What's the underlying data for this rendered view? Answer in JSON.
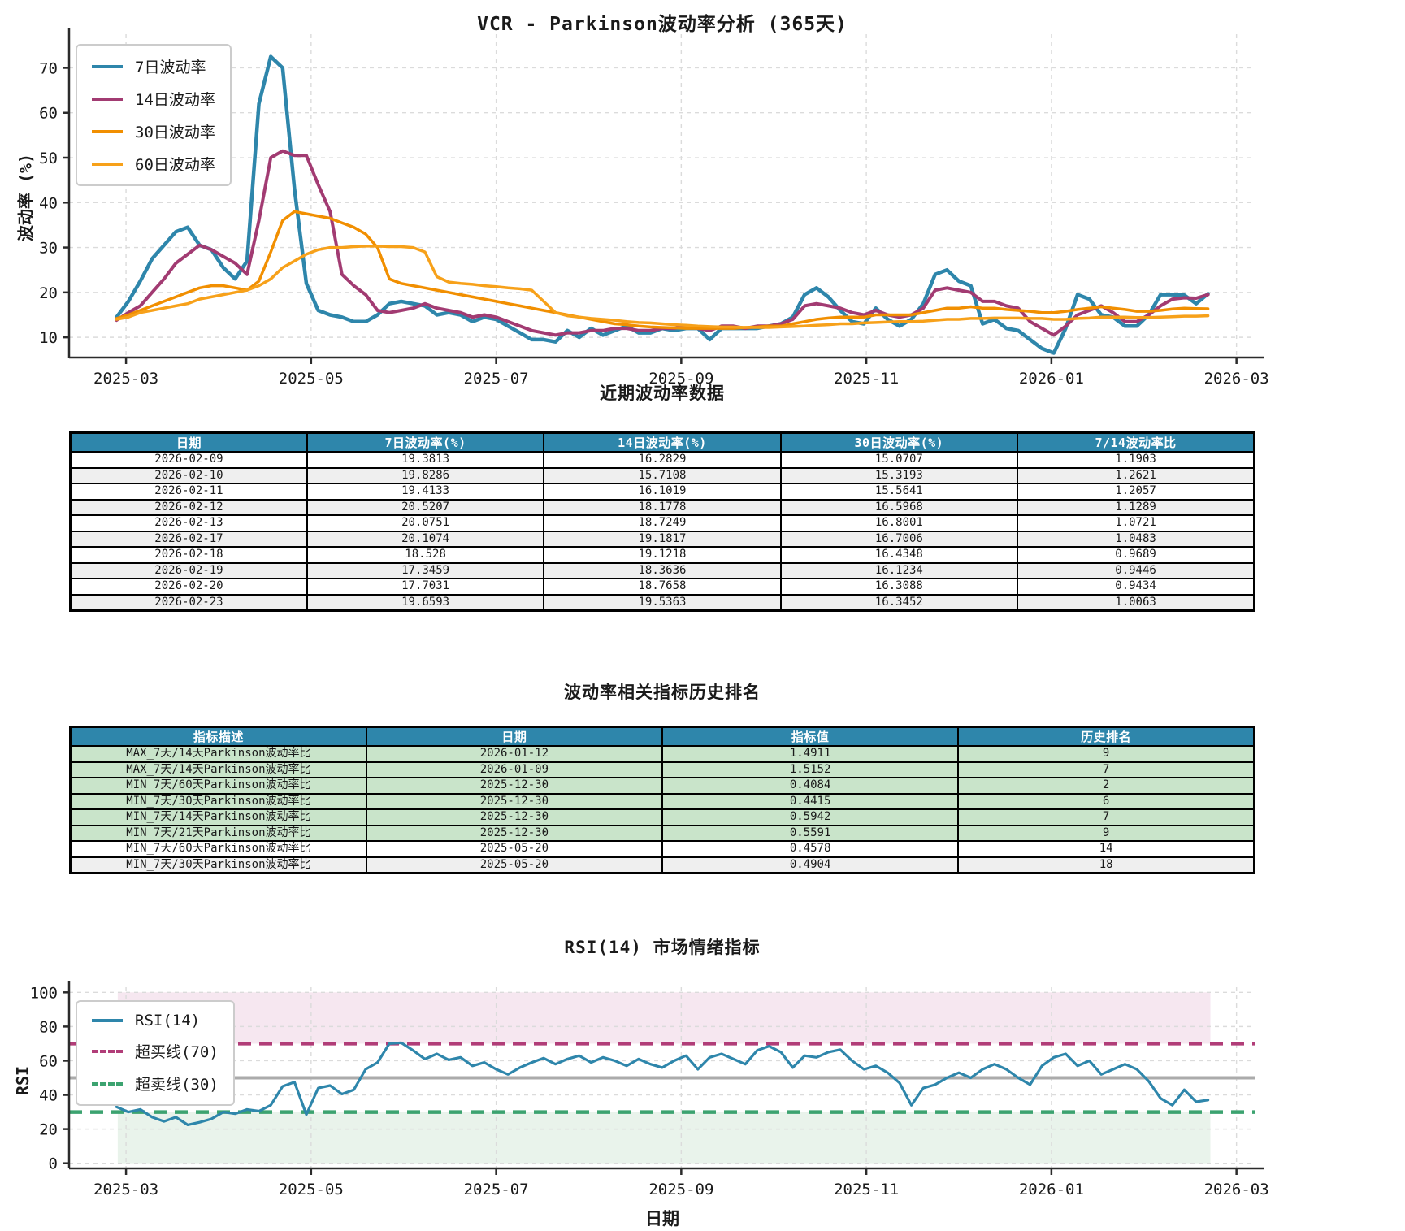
{
  "colors": {
    "vol7": "#2E86AB",
    "vol14": "#A23B72",
    "vol30": "#F18F01",
    "vol60": "#F7A11A",
    "rsi_line": "#2E86AB",
    "overbought": "#B13D78",
    "oversold": "#3CA370",
    "midline": "#ABABAB",
    "band_pink": "#F6E7F0",
    "band_green": "#E9F3EB",
    "header_bg": "#2E86AB",
    "row_alt": "#EFEFEF",
    "row_green": "#C9E4CA",
    "grid": "#DBDBDB",
    "spine": "#2B2B2B"
  },
  "sections": {
    "recent_table_title": "近期波动率数据",
    "ranking_table_title": "波动率相关指标历史排名"
  },
  "recent_table": {
    "headers": [
      "日期",
      "7日波动率(%)",
      "14日波动率(%)",
      "30日波动率(%)",
      "7/14波动率比"
    ],
    "rows": [
      [
        "2026-02-09",
        "19.3813",
        "16.2829",
        "15.0707",
        "1.1903"
      ],
      [
        "2026-02-10",
        "19.8286",
        "15.7108",
        "15.3193",
        "1.2621"
      ],
      [
        "2026-02-11",
        "19.4133",
        "16.1019",
        "15.5641",
        "1.2057"
      ],
      [
        "2026-02-12",
        "20.5207",
        "18.1778",
        "16.5968",
        "1.1289"
      ],
      [
        "2026-02-13",
        "20.0751",
        "18.7249",
        "16.8001",
        "1.0721"
      ],
      [
        "2026-02-17",
        "20.1074",
        "19.1817",
        "16.7006",
        "1.0483"
      ],
      [
        "2026-02-18",
        "18.528",
        "19.1218",
        "16.4348",
        "0.9689"
      ],
      [
        "2026-02-19",
        "17.3459",
        "18.3636",
        "16.1234",
        "0.9446"
      ],
      [
        "2026-02-20",
        "17.7031",
        "18.7658",
        "16.3088",
        "0.9434"
      ],
      [
        "2026-02-23",
        "19.6593",
        "19.5363",
        "16.3452",
        "1.0063"
      ]
    ]
  },
  "ranking_table": {
    "headers": [
      "指标描述",
      "日期",
      "指标值",
      "历史排名"
    ],
    "rows": [
      {
        "cells": [
          "MAX_7天/14天Parkinson波动率比",
          "2026-01-12",
          "1.4911",
          "9"
        ],
        "bg": "green"
      },
      {
        "cells": [
          "MAX_7天/14天Parkinson波动率比",
          "2026-01-09",
          "1.5152",
          "7"
        ],
        "bg": "green"
      },
      {
        "cells": [
          "MIN_7天/60天Parkinson波动率比",
          "2025-12-30",
          "0.4084",
          "2"
        ],
        "bg": "green"
      },
      {
        "cells": [
          "MIN_7天/30天Parkinson波动率比",
          "2025-12-30",
          "0.4415",
          "6"
        ],
        "bg": "green"
      },
      {
        "cells": [
          "MIN_7天/14天Parkinson波动率比",
          "2025-12-30",
          "0.5942",
          "7"
        ],
        "bg": "green"
      },
      {
        "cells": [
          "MIN_7天/21天Parkinson波动率比",
          "2025-12-30",
          "0.5591",
          "9"
        ],
        "bg": "green"
      },
      {
        "cells": [
          "MIN_7天/60天Parkinson波动率比",
          "2025-05-20",
          "0.4578",
          "14"
        ],
        "bg": "white"
      },
      {
        "cells": [
          "MIN_7天/30天Parkinson波动率比",
          "2025-05-20",
          "0.4904",
          "18"
        ],
        "bg": "gray"
      }
    ]
  },
  "chart_data": [
    {
      "id": "volatility",
      "type": "line",
      "title": "VCR - Parkinson波动率分析 (365天)",
      "ylabel": "波动率 (%)",
      "ylim": [
        5.5,
        77.5
      ],
      "yticks": [
        10,
        20,
        30,
        40,
        50,
        60,
        70
      ],
      "xticks": [
        {
          "label": "2025-03",
          "frac": 0.048
        },
        {
          "label": "2025-05",
          "frac": 0.204
        },
        {
          "label": "2025-07",
          "frac": 0.36
        },
        {
          "label": "2025-09",
          "frac": 0.516
        },
        {
          "label": "2025-11",
          "frac": 0.672
        },
        {
          "label": "2026-01",
          "frac": 0.828
        },
        {
          "label": "2026-03",
          "frac": 0.984
        }
      ],
      "x_start": 0.04,
      "x_step": 0.01,
      "legend_position": "upper left",
      "grid": true,
      "series": [
        {
          "name": "7日波动率",
          "color_key": "vol7",
          "width": 4.5,
          "values": [
            14.5,
            18,
            22.5,
            27.5,
            30.5,
            33.5,
            34.5,
            30.5,
            29.5,
            25.5,
            23,
            27,
            62,
            72.5,
            70,
            43,
            22,
            16,
            15,
            14.5,
            13.5,
            13.5,
            15,
            17.5,
            18,
            17.5,
            17,
            15,
            15.5,
            15,
            13.5,
            14.5,
            14,
            12.5,
            11,
            9.5,
            9.5,
            9,
            11.5,
            10,
            12,
            10.5,
            11.5,
            12.5,
            11,
            11,
            12,
            11.5,
            12,
            12,
            9.5,
            12,
            12,
            12,
            12,
            12.5,
            13,
            14.5,
            19.5,
            21,
            19,
            16,
            13.5,
            13,
            16.5,
            14,
            12.5,
            14,
            17.5,
            24,
            25,
            22.5,
            21.5,
            13,
            14,
            12,
            11.5,
            9.5,
            7.5,
            6.5,
            12,
            19.5,
            18.5,
            15,
            14.5,
            12.5,
            12.5,
            15,
            19.5,
            19.5,
            19.4,
            17.5,
            19.7
          ]
        },
        {
          "name": "14日波动率",
          "color_key": "vol14",
          "width": 4,
          "values": [
            13.8,
            15.5,
            17,
            20,
            23,
            26.5,
            28.5,
            30.5,
            29.5,
            28,
            26.5,
            24,
            36,
            50,
            51.5,
            50.5,
            50.5,
            44,
            38,
            24,
            21.5,
            19.5,
            16,
            15.5,
            16,
            16.5,
            17.5,
            16.5,
            16,
            15.5,
            14.5,
            15,
            14.5,
            13.5,
            12.5,
            11.5,
            11,
            10.5,
            11,
            11,
            11.5,
            11.5,
            12,
            12,
            11.5,
            11.5,
            12,
            12,
            12.5,
            12,
            11.5,
            12.5,
            12.5,
            12,
            12.5,
            12.5,
            13,
            14,
            17,
            17.5,
            17,
            16.5,
            15.5,
            15,
            16,
            15,
            14.5,
            15,
            16.5,
            20.5,
            21,
            20.5,
            20,
            18,
            18,
            17,
            16.5,
            13.5,
            12,
            10.5,
            12.5,
            15,
            16,
            17,
            15.5,
            13.5,
            13.5,
            15,
            17,
            18.5,
            18.8,
            18.7,
            19.5
          ]
        },
        {
          "name": "30日波动率",
          "color_key": "vol30",
          "width": 3.5,
          "values": [
            14.2,
            15,
            16,
            17,
            18,
            19,
            20,
            21,
            21.5,
            21.5,
            21,
            20.5,
            22.5,
            29,
            36,
            38,
            37.5,
            37,
            36.5,
            35.5,
            34.5,
            33,
            30,
            23,
            22,
            21.5,
            21,
            20.5,
            20,
            19.5,
            19,
            18.5,
            18,
            17.5,
            17,
            16.5,
            16,
            15.5,
            15,
            14.5,
            14,
            13.5,
            13,
            12.8,
            12.5,
            12.3,
            12.2,
            12.1,
            12,
            12,
            12,
            12,
            12,
            12.2,
            12.3,
            12.5,
            12.5,
            13,
            13.5,
            14,
            14.3,
            14.5,
            14.5,
            14.5,
            15,
            15,
            15,
            15,
            15.5,
            16,
            16.5,
            16.5,
            16.8,
            16.5,
            16.5,
            16.2,
            16,
            15.8,
            15.5,
            15.5,
            15.8,
            16.2,
            16.5,
            16.8,
            16.5,
            16.2,
            15.8,
            15.8,
            16,
            16.3,
            16.5,
            16.4,
            16.35
          ]
        },
        {
          "name": "60日波动率",
          "color_key": "vol60",
          "width": 3.5,
          "values": [
            14,
            14.5,
            15.5,
            16,
            16.5,
            17,
            17.5,
            18.5,
            19,
            19.5,
            20,
            20.5,
            21.5,
            23,
            25.5,
            27,
            28.5,
            29.5,
            30,
            30,
            30.2,
            30.3,
            30.3,
            30.2,
            30.2,
            30,
            29,
            23.5,
            22.3,
            22,
            21.8,
            21.5,
            21.3,
            21,
            20.8,
            20.5,
            18,
            15.5,
            14.8,
            14.5,
            14.2,
            14,
            13.8,
            13.5,
            13.3,
            13.2,
            13,
            12.8,
            12.7,
            12.5,
            12.4,
            12.3,
            12.3,
            12.2,
            12.2,
            12.2,
            12.3,
            12.4,
            12.5,
            12.7,
            12.8,
            13,
            13,
            13.2,
            13.3,
            13.4,
            13.5,
            13.5,
            13.6,
            13.8,
            14,
            14,
            14.2,
            14.2,
            14.3,
            14.3,
            14.3,
            14.2,
            14.2,
            14,
            14,
            14.2,
            14.3,
            14.5,
            14.5,
            14.5,
            14.4,
            14.4,
            14.5,
            14.6,
            14.7,
            14.7,
            14.8
          ]
        }
      ]
    },
    {
      "id": "rsi",
      "type": "line",
      "title": "RSI(14) 市场情绪指标",
      "xlabel": "日期",
      "ylabel": "RSI",
      "ylim": [
        -3,
        103
      ],
      "yticks": [
        0,
        20,
        40,
        60,
        80,
        100
      ],
      "xticks": [
        {
          "label": "2025-03",
          "frac": 0.048
        },
        {
          "label": "2025-05",
          "frac": 0.204
        },
        {
          "label": "2025-07",
          "frac": 0.36
        },
        {
          "label": "2025-09",
          "frac": 0.516
        },
        {
          "label": "2025-11",
          "frac": 0.672
        },
        {
          "label": "2026-01",
          "frac": 0.828
        },
        {
          "label": "2026-03",
          "frac": 0.984
        }
      ],
      "x_start": 0.04,
      "x_step": 0.01,
      "legend_position": "upper left",
      "grid": true,
      "bands": [
        {
          "from": 70,
          "to": 100,
          "color_key": "band_pink",
          "x_from": 0.041,
          "x_to": 0.962
        },
        {
          "from": 0,
          "to": 30,
          "color_key": "band_green",
          "x_from": 0.041,
          "x_to": 0.962
        }
      ],
      "ref_lines": [
        {
          "name": "超买线(70)",
          "value": 70,
          "color_key": "overbought",
          "style": "dashed",
          "in_legend": true
        },
        {
          "name": "超卖线(30)",
          "value": 30,
          "color_key": "oversold",
          "style": "dashed",
          "in_legend": true
        },
        {
          "name": "中线(50)",
          "value": 50,
          "color_key": "midline",
          "style": "solid",
          "in_legend": false
        }
      ],
      "series": [
        {
          "name": "RSI(14)",
          "color_key": "rsi_line",
          "width": 3.2,
          "values": [
            33,
            30,
            31.5,
            27,
            24.5,
            27,
            22.5,
            24,
            26,
            30,
            29,
            31.5,
            30.5,
            34,
            45,
            47.5,
            28.5,
            44,
            45.5,
            40.5,
            43,
            55,
            59,
            70,
            70.5,
            66,
            61,
            64,
            60.5,
            62,
            57,
            59,
            55,
            52,
            56,
            59,
            61.5,
            58,
            61,
            63,
            59,
            62,
            60,
            57,
            61,
            58,
            56,
            60,
            63,
            55,
            62,
            64,
            61,
            58,
            66,
            68.5,
            65,
            56,
            63,
            62,
            65,
            66.5,
            60,
            55,
            57,
            53,
            47,
            34,
            44,
            46,
            50,
            53,
            50,
            55,
            58,
            55,
            50,
            46,
            57,
            62,
            64,
            57,
            60,
            52,
            55,
            58,
            55,
            48,
            38,
            34,
            43,
            36,
            37
          ]
        }
      ]
    }
  ]
}
